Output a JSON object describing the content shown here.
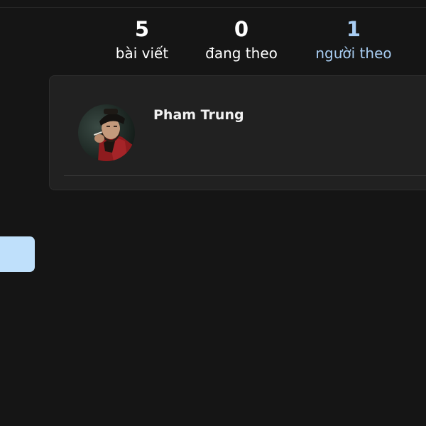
{
  "stats": {
    "posts": {
      "count": "5",
      "label": "bài viết"
    },
    "following": {
      "count": "0",
      "label": "đang theo"
    },
    "followers": {
      "count": "1",
      "label": "người theo"
    }
  },
  "followers_list": [
    {
      "name": "Pham Trung",
      "avatar_icon": "user-photo"
    }
  ],
  "colors": {
    "background": "#151515",
    "panel": "#212121",
    "accent": "#a8cdf2",
    "button": "#bfe0fb"
  }
}
